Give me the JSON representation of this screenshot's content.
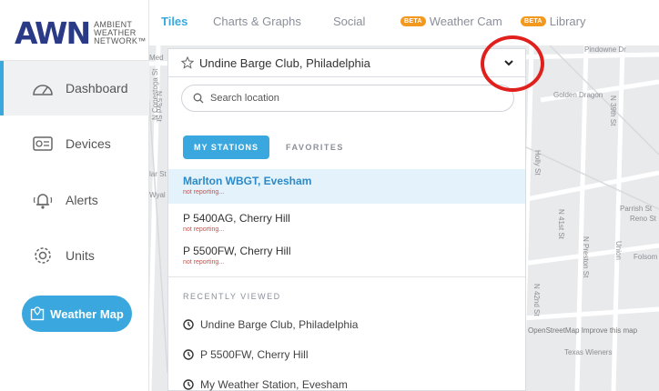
{
  "logo": {
    "mark": "AWN",
    "line1": "AMBIENT",
    "line2": "WEATHER",
    "line3": "NETWORK™"
  },
  "sidebar": {
    "items": [
      {
        "label": "Dashboard",
        "icon": "dashboard-gauge-icon"
      },
      {
        "label": "Devices",
        "icon": "device-icon"
      },
      {
        "label": "Alerts",
        "icon": "bell-icon"
      },
      {
        "label": "Units",
        "icon": "gear-icon"
      }
    ],
    "weather_map_label": "Weather Map"
  },
  "tabs": [
    {
      "label": "Tiles"
    },
    {
      "label": "Charts & Graphs"
    },
    {
      "label": "Social"
    },
    {
      "label": "Weather Cam",
      "badge": "BETA"
    },
    {
      "label": "Library",
      "badge": "BETA"
    }
  ],
  "location": {
    "selected": "Undine Barge Club, Philadelphia"
  },
  "search": {
    "placeholder": "Search location"
  },
  "station_tabs": {
    "my_stations": "MY STATIONS",
    "favorites": "FAVORITES"
  },
  "stations": [
    {
      "name": "Marlton WBGT, Evesham",
      "status": "not reporting..."
    },
    {
      "name": "P 5400AG, Cherry Hill",
      "status": "not reporting..."
    },
    {
      "name": "P 5500FW, Cherry Hill",
      "status": "not reporting..."
    }
  ],
  "recently_viewed": {
    "heading": "RECENTLY VIEWED",
    "items": [
      {
        "name": "Undine Barge Club, Philadelphia"
      },
      {
        "name": "P 5500FW, Cherry Hill"
      },
      {
        "name": "My Weather Station, Evesham"
      }
    ]
  },
  "map": {
    "labels": [
      "Golden Dragon",
      "N 39th St",
      "Holly St",
      "N 41st St",
      "N Preston St",
      "Union",
      "Parrish St",
      "Reno St",
      "Folsom",
      "N 42nd St",
      "Med",
      "N Conestoga St",
      "N 53rd St",
      "lar St",
      "Wyal",
      "Pindowne Dr",
      "Texas Wieners"
    ],
    "attribution": "OpenStreetMap Improve this map"
  },
  "colors": {
    "accent": "#3aa8de",
    "brand": "#2a3a86",
    "beta": "#f39a1e",
    "status_red": "#e2443c",
    "annotation": "#e0201c"
  }
}
